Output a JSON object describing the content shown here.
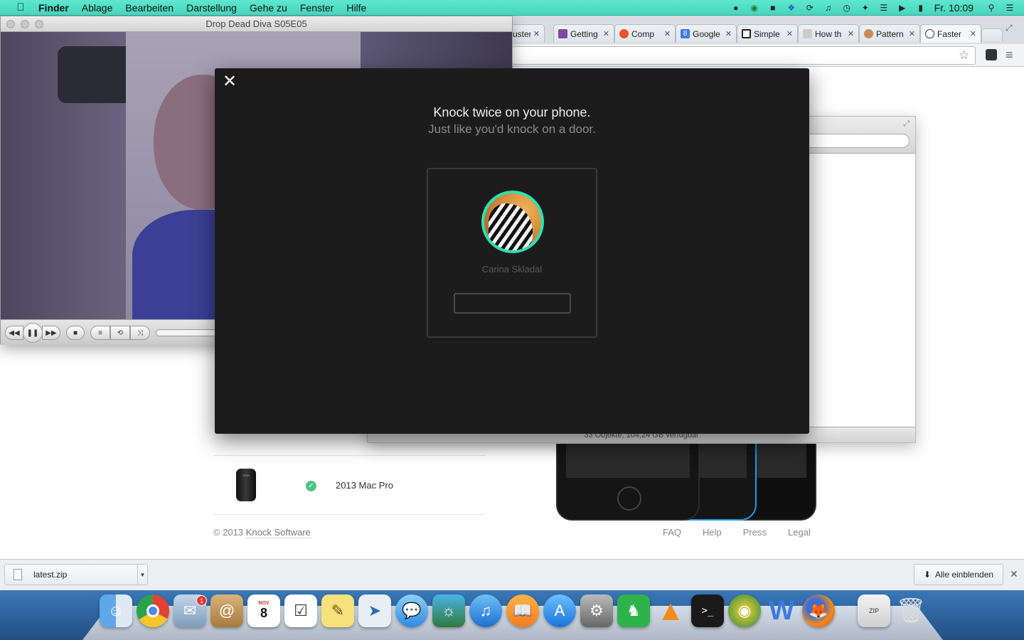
{
  "menubar": {
    "app_name": "Finder",
    "items": [
      "Ablage",
      "Bearbeiten",
      "Darstellung",
      "Gehe zu",
      "Fenster",
      "Hilfe"
    ],
    "clock": "Fr. 10:09"
  },
  "browser": {
    "tabs": [
      {
        "label": "uster"
      },
      {
        "label": "Getting"
      },
      {
        "label": "Comp"
      },
      {
        "label": "Google"
      },
      {
        "label": "Simple"
      },
      {
        "label": "How th"
      },
      {
        "label": "Pattern"
      },
      {
        "label": "Faster"
      }
    ]
  },
  "vlc": {
    "title": "Drop Dead Diva S05E05"
  },
  "finder": {
    "status": "33 Objekte, 104,24 GB verfügbar"
  },
  "page": {
    "product_name": "2013 Mac Pro",
    "footer_copyright": "© 2013 ",
    "footer_company": "Knock Software",
    "footer_links": [
      "FAQ",
      "Help",
      "Press",
      "Legal"
    ]
  },
  "modal": {
    "headline": "Knock twice on your phone.",
    "subline": "Just like you'd knock on a door.",
    "user_name": "Carina Skladal"
  },
  "downloads": {
    "file_name": "latest.zip",
    "show_all_label": "Alle einblenden"
  },
  "dock": {
    "mail_badge": "1",
    "calendar_month": "NOV",
    "calendar_day": "8"
  }
}
